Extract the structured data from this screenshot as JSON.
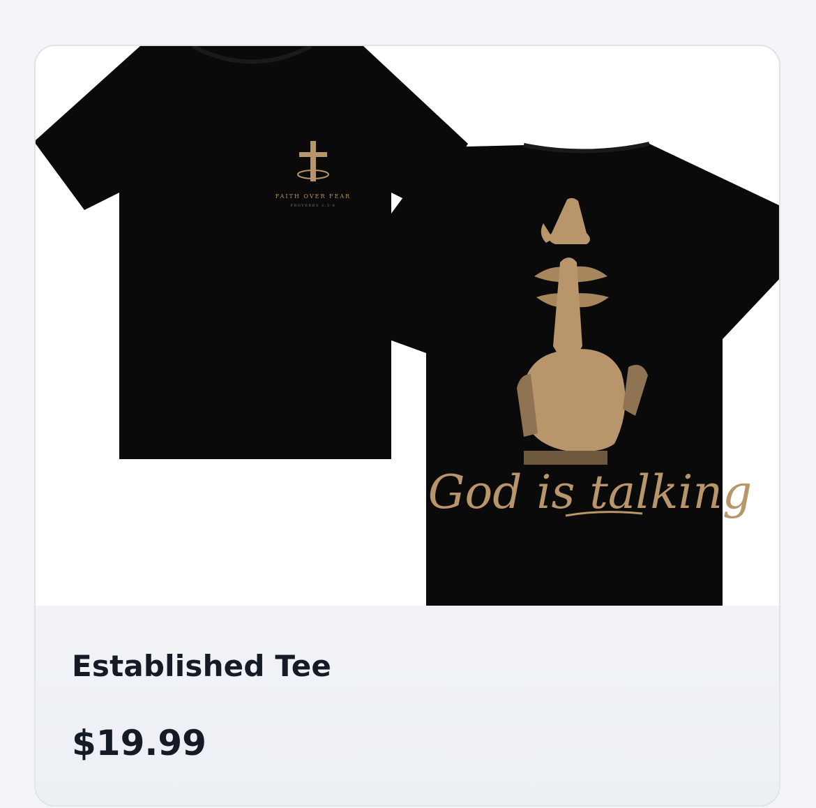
{
  "product": {
    "name": "Established Tee",
    "price": "$19.99",
    "image": {
      "front_print_line1": "FAITH OVER FEAR",
      "front_print_line2": "PROVERBS 3:5-6",
      "back_print_text": "God is talking",
      "shirt_color": "#0a0a0a",
      "print_color": "#b8956a"
    }
  }
}
